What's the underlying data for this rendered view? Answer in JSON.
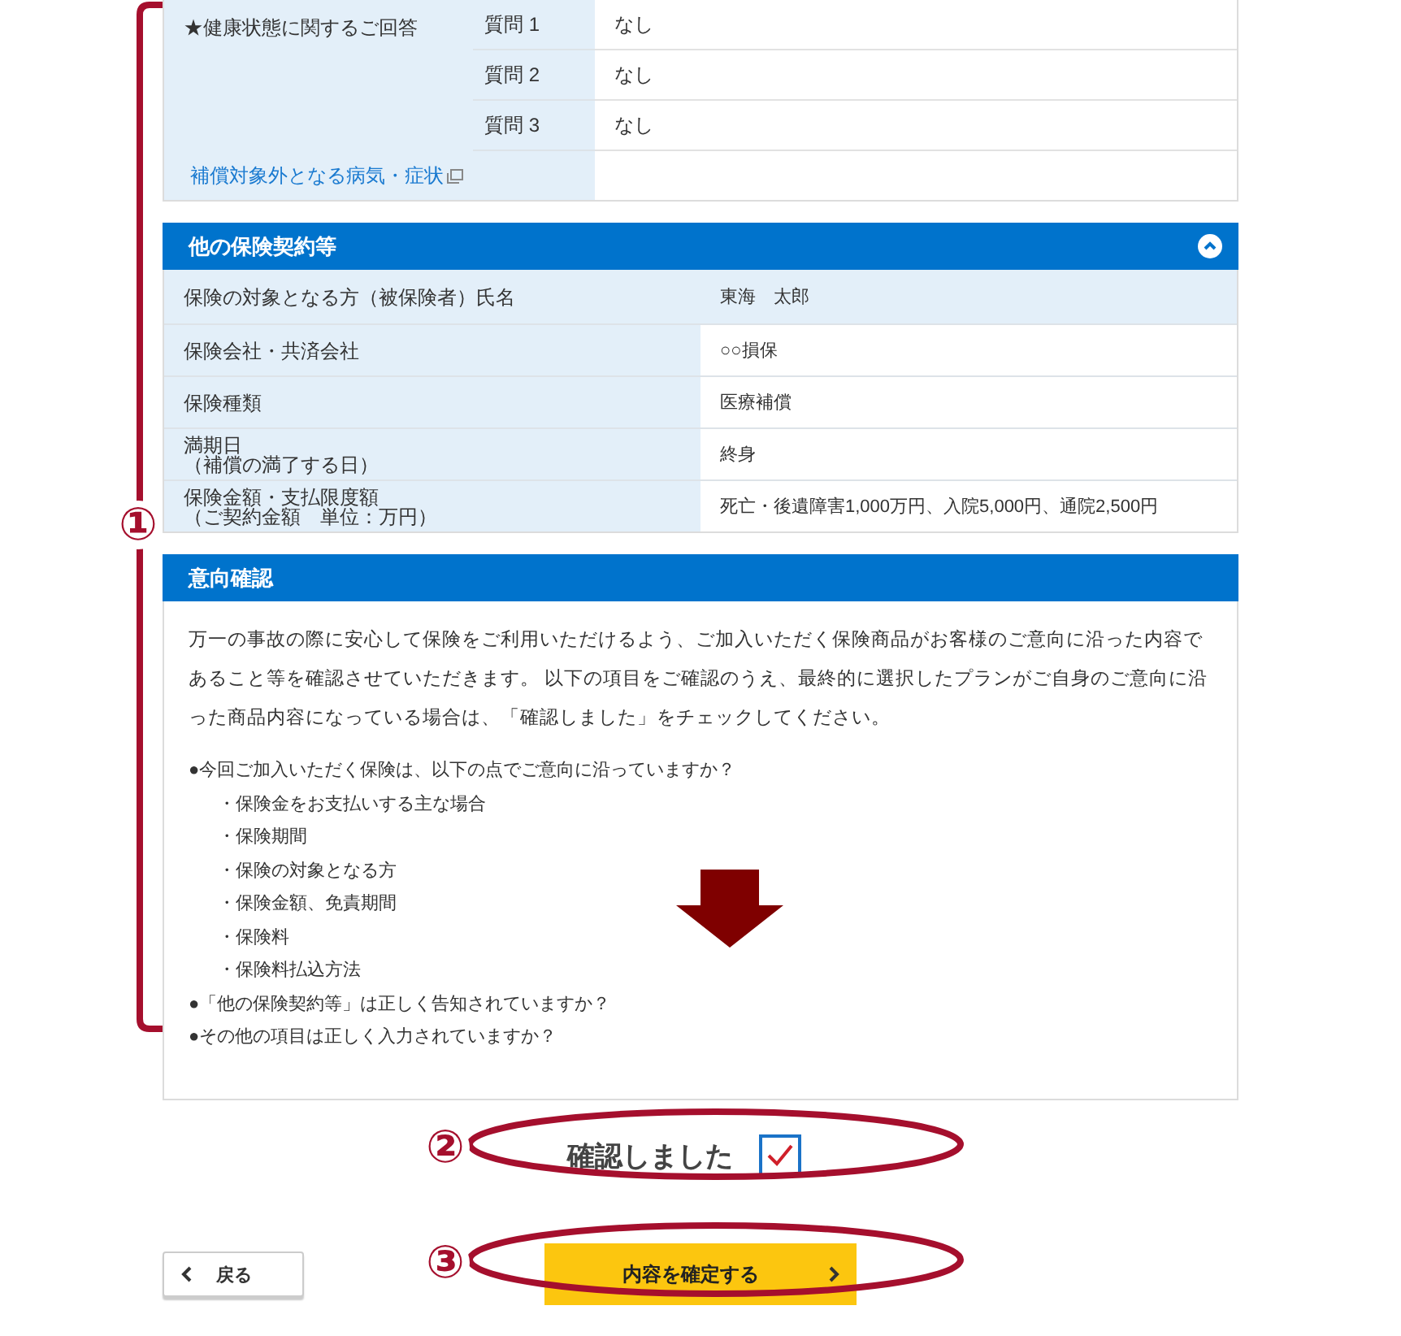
{
  "health": {
    "label": "★健康状態に関するご回答",
    "questions": [
      {
        "label": "質問 1",
        "answer": "なし"
      },
      {
        "label": "質問 2",
        "answer": "なし"
      },
      {
        "label": "質問 3",
        "answer": "なし"
      }
    ],
    "exclusions_link": "補償対象外となる病気・症状"
  },
  "other_contracts": {
    "title": "他の保険契約等",
    "expanded": true,
    "rows": [
      {
        "label_lines": [
          "保険の対象となる方（被保険者）氏名"
        ],
        "value": "東海　太郎"
      },
      {
        "label_lines": [
          "保険会社・共済会社"
        ],
        "value": "○○損保"
      },
      {
        "label_lines": [
          "保険種類"
        ],
        "value": "医療補償"
      },
      {
        "label_lines": [
          "満期日",
          "（補償の満了する日）"
        ],
        "value": "終身"
      },
      {
        "label_lines": [
          "保険金額・支払限度額",
          "（ご契約金額　単位：万円）"
        ],
        "value": "死亡・後遺障害1,000万円、入院5,000円、通院2,500円"
      }
    ]
  },
  "intent": {
    "title": "意向確認",
    "intro": "万一の事故の際に安心して保険をご利用いただけるよう、ご加入いただく保険商品がお客様のご意向に沿った内容であること等を確認させていただきます。 以下の項目をご確認のうえ、最終的に選択したプランがご自身のご意向に沿った商品内容になっている場合は、「確認しました」をチェックしてください。",
    "items": [
      {
        "text": "●今回ご加入いただく保険は、以下の点でご意向に沿っていますか？",
        "children": [
          {
            "text": "・保険金をお支払いする主な場合"
          },
          {
            "text": "・保険期間"
          },
          {
            "text": "・保険の対象となる方"
          },
          {
            "text": "・保険金額、免責期間"
          },
          {
            "text": "・保険料"
          },
          {
            "text": "・保険料払込方法"
          }
        ]
      },
      {
        "text": "●「他の保険契約等」は正しく告知されていますか？"
      },
      {
        "text": "●その他の項目は正しく入力されていますか？"
      }
    ]
  },
  "confirm": {
    "label": "確認しました",
    "checked": true
  },
  "buttons": {
    "back": "戻る",
    "next": "内容を確定する"
  },
  "annotations": [
    {
      "number": "①"
    },
    {
      "number": "②"
    },
    {
      "number": "③"
    }
  ]
}
